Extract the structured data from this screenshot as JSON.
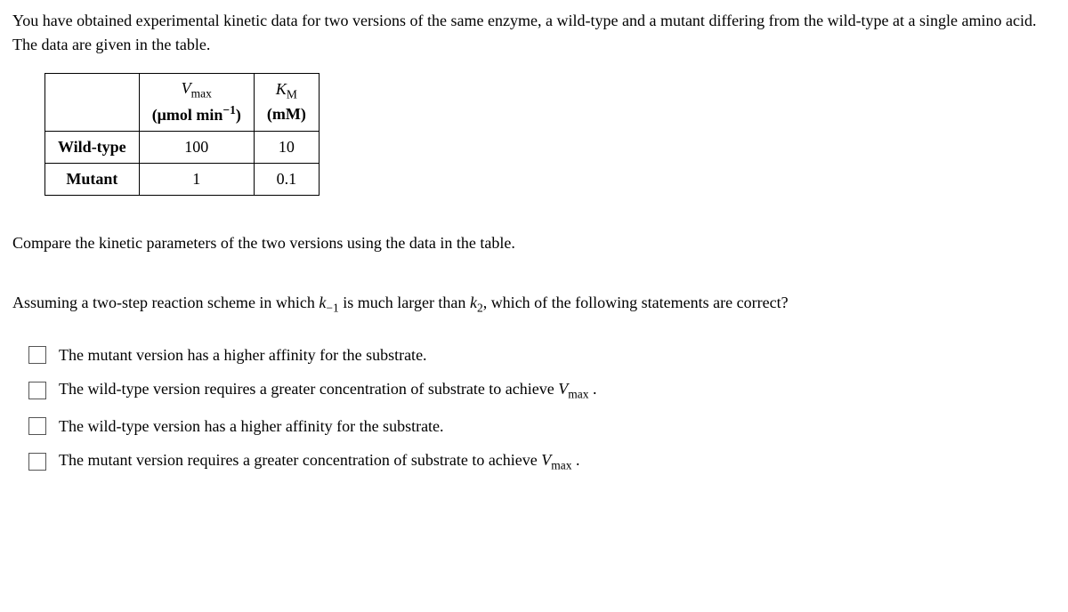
{
  "intro": "You have obtained experimental kinetic data for two versions of the same enzyme, a wild-type and a mutant differing from the wild-type at a single amino acid. The data are given in the table.",
  "table": {
    "headers": {
      "vmax_symbol": "V",
      "vmax_sub": "max",
      "vmax_units": "(μmol min",
      "vmax_exp": "−1",
      "vmax_close": ")",
      "km_symbol": "K",
      "km_sub": "M",
      "km_units": "(mM)"
    },
    "rows": [
      {
        "label": "Wild-type",
        "vmax": "100",
        "km": "10"
      },
      {
        "label": "Mutant",
        "vmax": "1",
        "km": "0.1"
      }
    ]
  },
  "compare_prompt": "Compare the kinetic parameters of the two versions using the data in the table.",
  "question": {
    "prefix": "Assuming a two-step reaction scheme in which ",
    "k_neg1": "k",
    "k_neg1_sub": "−1",
    "mid": " is much larger than ",
    "k2": "k",
    "k2_sub": "2",
    "suffix": ", which of the following statements are correct?"
  },
  "options": [
    {
      "text": "The mutant version has a higher affinity for the substrate."
    },
    {
      "prefix": "The wild-type version requires a greater concentration of substrate to achieve ",
      "vsym": "V",
      "vsub": "max",
      "suffix": " ."
    },
    {
      "text": "The wild-type version has a higher affinity for the substrate."
    },
    {
      "prefix": "The mutant version requires a greater concentration of substrate to achieve ",
      "vsym": "V",
      "vsub": "max",
      "suffix": " ."
    }
  ]
}
